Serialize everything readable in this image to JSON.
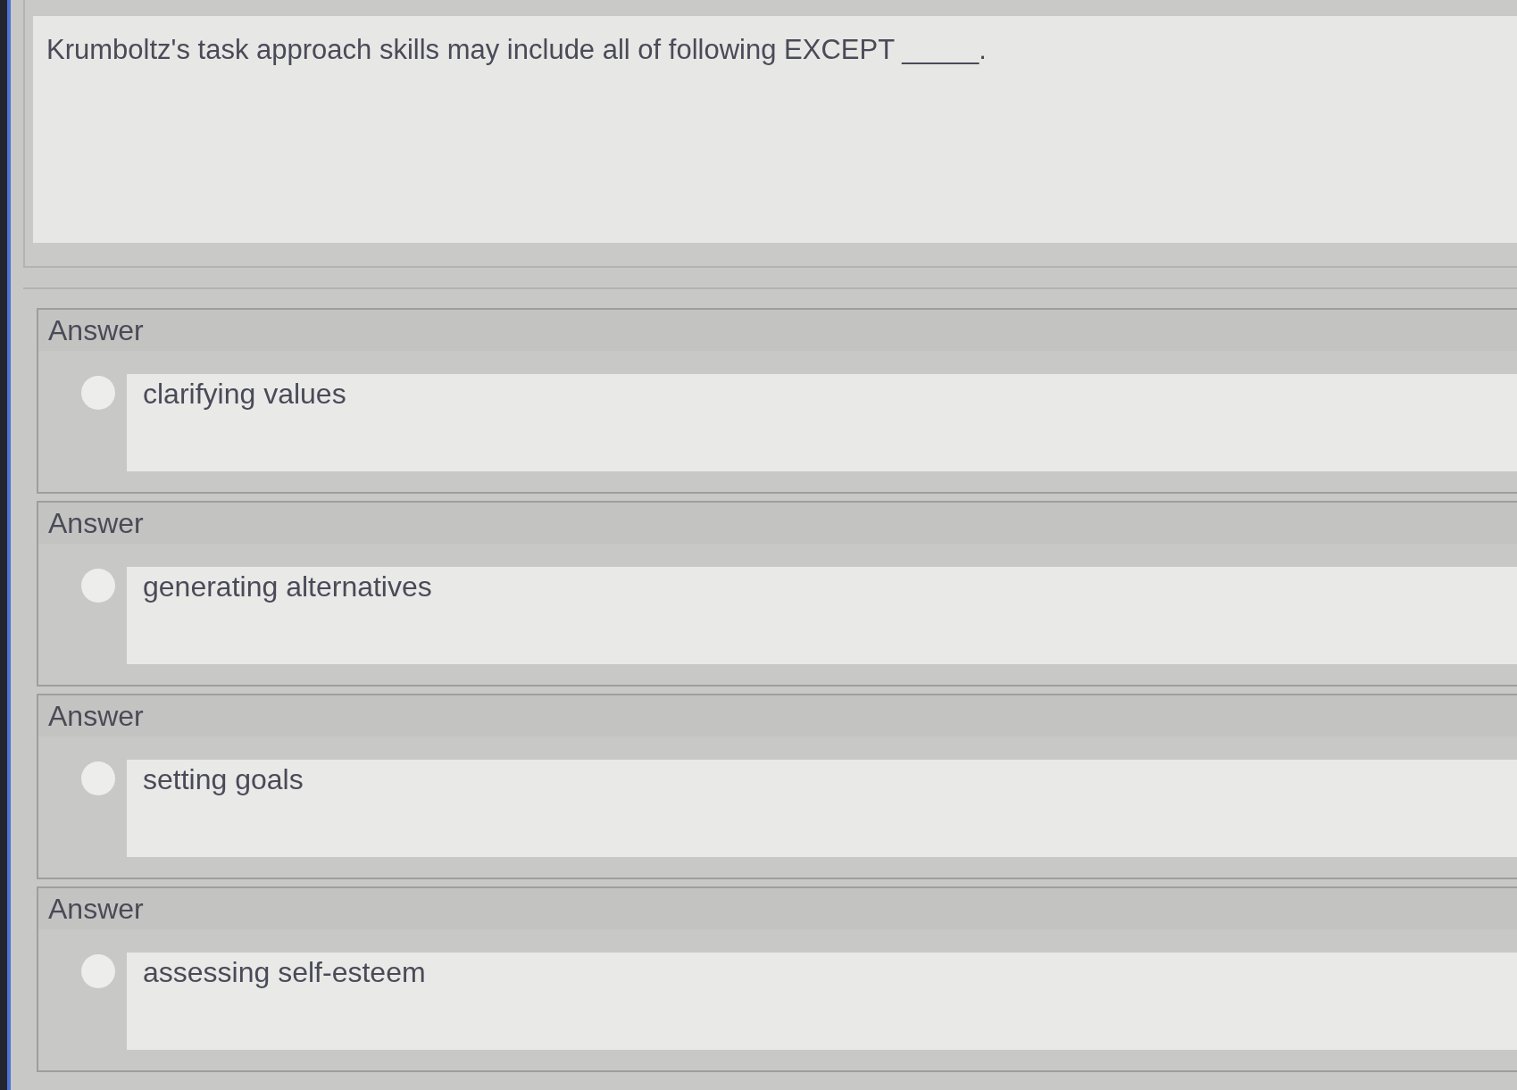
{
  "question": {
    "text": "Krumboltz's task approach skills may include all of following EXCEPT _____."
  },
  "answers": [
    {
      "label": "Answer",
      "text": "clarifying values",
      "selected": false
    },
    {
      "label": "Answer",
      "text": "generating alternatives",
      "selected": false
    },
    {
      "label": "Answer",
      "text": "setting goals",
      "selected": false
    },
    {
      "label": "Answer",
      "text": "assessing self-esteem",
      "selected": false
    }
  ]
}
